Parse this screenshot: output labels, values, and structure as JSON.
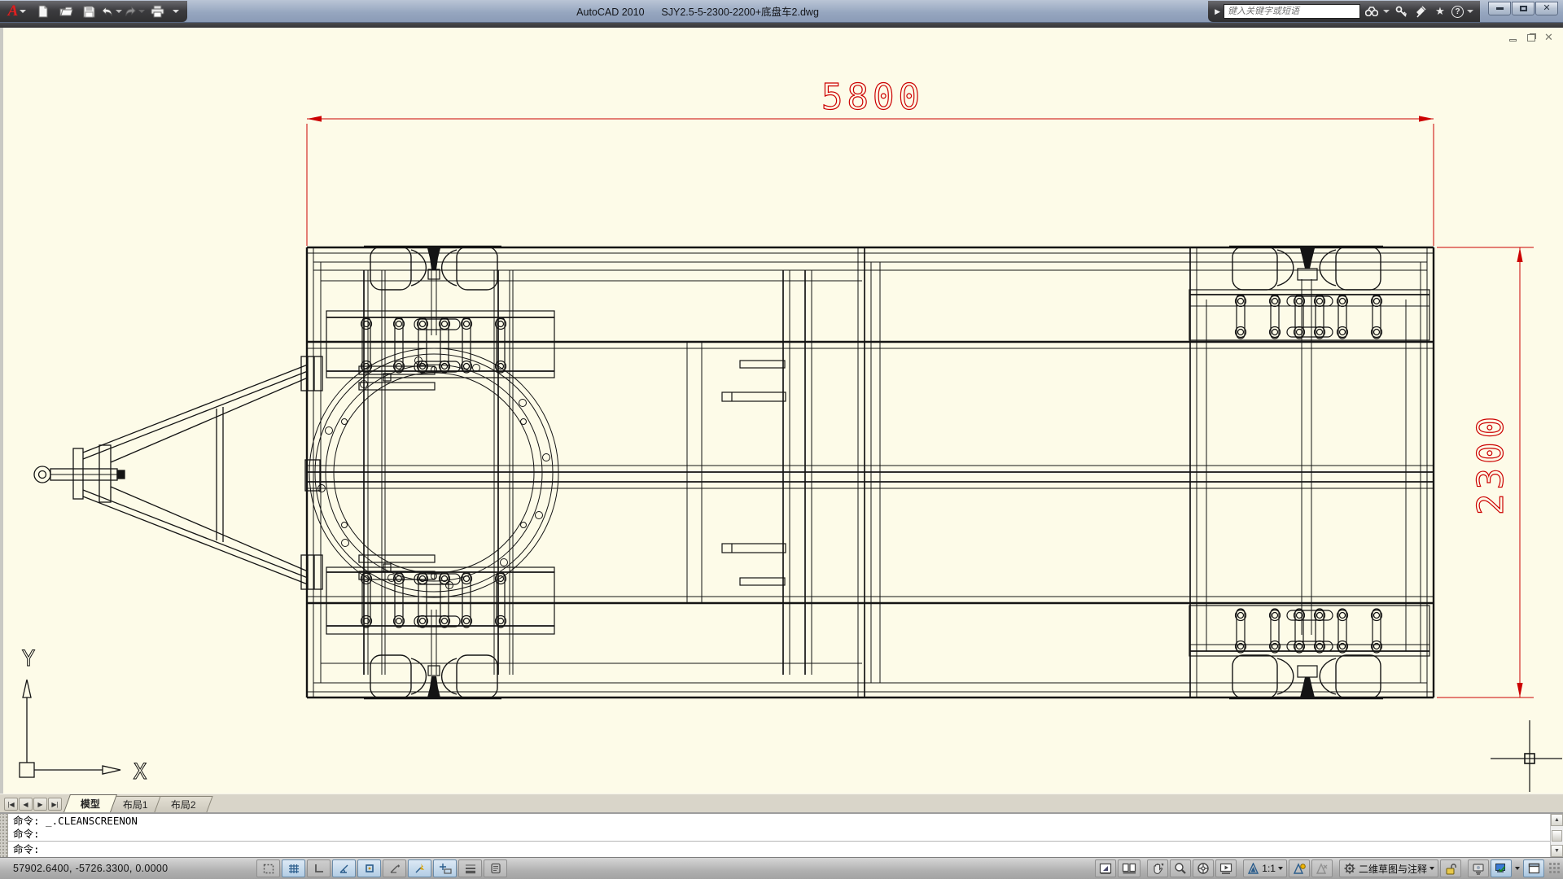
{
  "window": {
    "app_title": "AutoCAD 2010",
    "doc_title": "SJY2.5-5-2300-2200+底盘车2.dwg",
    "controls": [
      "minimize",
      "restore",
      "close"
    ]
  },
  "qat": {
    "icons": [
      "autocad-logo",
      "menu-arrow",
      "new",
      "open",
      "save",
      "undo",
      "redo",
      "plot",
      "toolbar-overflow"
    ]
  },
  "infocenter": {
    "placeholder": "键入关键字或短语",
    "icons": [
      "search-toggle-arrow",
      "binoculars-search",
      "search-options-arrow",
      "subscription-key",
      "communication-satellite",
      "favorites-star",
      "help"
    ]
  },
  "document_window": {
    "controls": [
      "minimize",
      "restore",
      "close"
    ]
  },
  "drawing": {
    "dim_length": "5800",
    "dim_width": "2300",
    "ucs_x": "X",
    "ucs_y": "Y",
    "dimension_color": "#cc0000",
    "line_color": "#141414",
    "background": "#fdfbe8"
  },
  "tabs": {
    "model": "模型",
    "layout1": "布局1",
    "layout2": "布局2"
  },
  "command": {
    "history1": "命令: _.CLEANSCREENON",
    "history2": "命令:",
    "prompt": "命令:"
  },
  "status": {
    "coordinates": "57902.6400, -5726.3300, 0.0000",
    "toggles": [
      {
        "name": "snap",
        "on": false
      },
      {
        "name": "grid",
        "on": true
      },
      {
        "name": "ortho",
        "on": false
      },
      {
        "name": "polar",
        "on": true
      },
      {
        "name": "osnap",
        "on": true
      },
      {
        "name": "otrack",
        "on": false
      },
      {
        "name": "ducs",
        "on": true
      },
      {
        "name": "dyn",
        "on": true
      },
      {
        "name": "lwt",
        "on": false
      },
      {
        "name": "qp",
        "on": false
      }
    ],
    "annotation_scale": "1:1",
    "workspace": "二维草图与注释",
    "right_icons": [
      "model-space",
      "quick-view-layouts",
      "pan",
      "zoom",
      "steering-wheel",
      "show-motion",
      "annotation-scale",
      "annotation-visibility",
      "auto-annotation",
      "workspace-switch",
      "lock",
      "isolate-objects",
      "performance",
      "status-menu",
      "clean-screen",
      "resize-grip"
    ]
  }
}
